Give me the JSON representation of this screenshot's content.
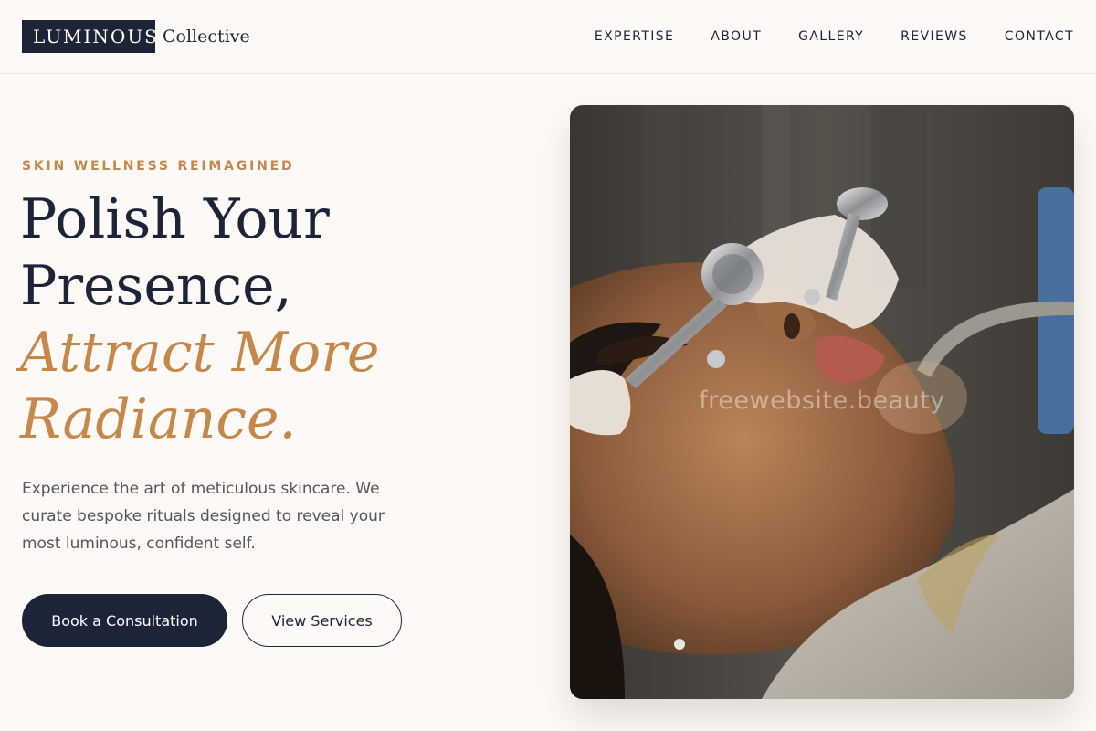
{
  "brand": {
    "logo_text": "LUMINOUS",
    "logo_suffix": "Collective"
  },
  "nav": {
    "items": [
      {
        "label": "EXPERTISE"
      },
      {
        "label": "ABOUT"
      },
      {
        "label": "GALLERY"
      },
      {
        "label": "REVIEWS"
      },
      {
        "label": "CONTACT"
      }
    ]
  },
  "hero": {
    "eyebrow": "SKIN WELLNESS REIMAGINED",
    "headline_line1": "Polish Your",
    "headline_line2": "Presence,",
    "headline_accent_line1": "Attract More",
    "headline_accent_line2": "Radiance.",
    "description": "Experience the art of meticulous skincare. We curate bespoke rituals designed to reveal your most luminous, confident self.",
    "primary_button": "Book a Consultation",
    "secondary_button": "View Services",
    "image_watermark": "freewebsite.beauty"
  },
  "colors": {
    "navy": "#1c2537",
    "accent": "#c6874a",
    "background": "#fdf9f7",
    "body_text": "#55565a"
  },
  "icons": {
    "hero_image": "facial-treatment-photo"
  }
}
